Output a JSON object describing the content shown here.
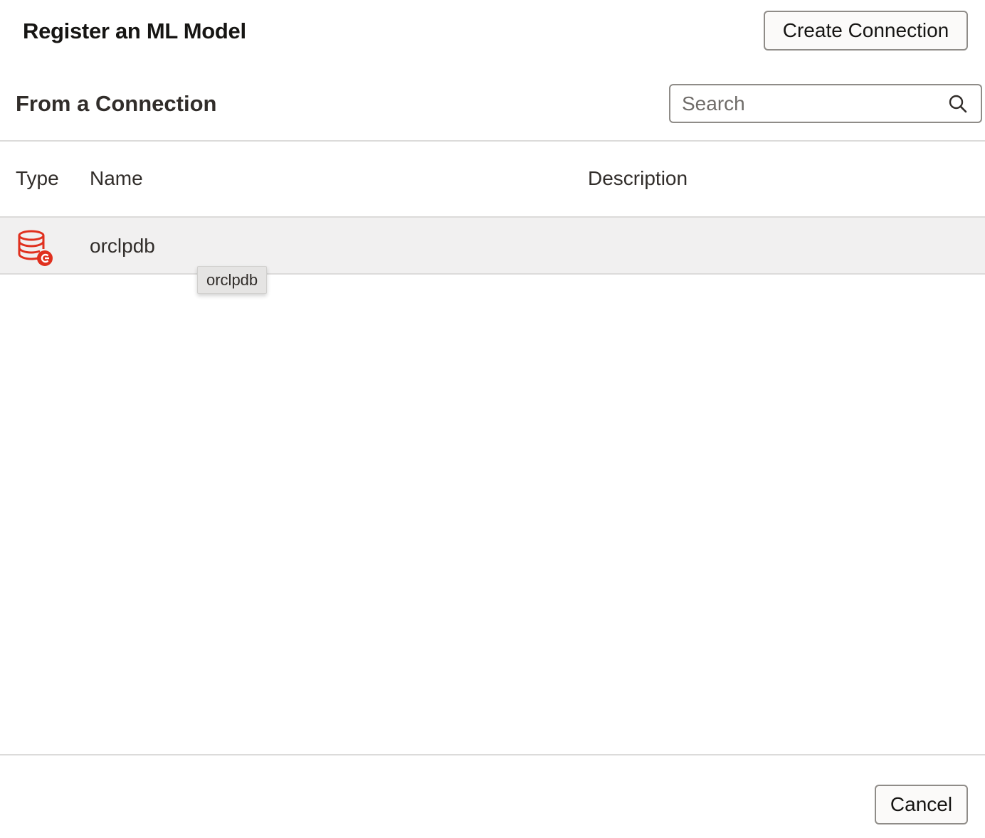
{
  "dialog": {
    "title": "Register an ML Model",
    "create_connection_label": "Create Connection",
    "cancel_label": "Cancel"
  },
  "section": {
    "title": "From a Connection"
  },
  "search": {
    "placeholder": "Search",
    "value": "",
    "icon": "search-icon"
  },
  "table": {
    "columns": [
      "Type",
      "Name",
      "Description"
    ],
    "rows": [
      {
        "type_icon": "database-connection-icon",
        "name": "orclpdb",
        "description": ""
      }
    ]
  },
  "tooltip": {
    "text": "orclpdb"
  },
  "colors": {
    "accent_icon": "#e0301e",
    "row_hover": "#f1f0f0",
    "border": "#8f8c88"
  }
}
